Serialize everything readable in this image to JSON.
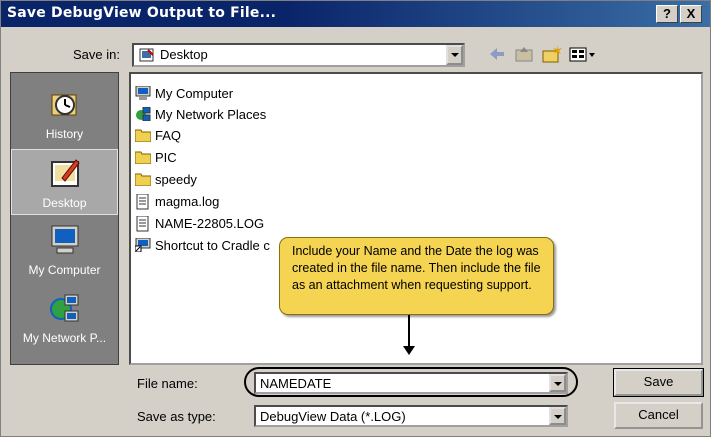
{
  "window": {
    "title": "Save DebugView Output to File...",
    "help_label": "?",
    "close_label": "X"
  },
  "save_in": {
    "label": "Save in:",
    "value": "Desktop"
  },
  "places": [
    {
      "label": "History",
      "icon": "history-icon"
    },
    {
      "label": "Desktop",
      "icon": "desktop-icon",
      "active": true
    },
    {
      "label": "My Computer",
      "icon": "my-computer-icon"
    },
    {
      "label": "My Network P...",
      "icon": "network-places-icon"
    }
  ],
  "files": [
    {
      "name": "My Computer",
      "icon": "computer-icon"
    },
    {
      "name": "My Network Places",
      "icon": "network-icon"
    },
    {
      "name": "FAQ",
      "icon": "folder-icon"
    },
    {
      "name": "PIC",
      "icon": "folder-icon"
    },
    {
      "name": "speedy",
      "icon": "folder-icon"
    },
    {
      "name": "magma.log",
      "icon": "text-file-icon"
    },
    {
      "name": "NAME-22805.LOG",
      "icon": "text-file-icon"
    },
    {
      "name": "Shortcut to Cradle c",
      "icon": "shortcut-icon"
    }
  ],
  "callout": {
    "text": "Include your Name and the Date the log was created in the file name. Then include the file as an attachment when requesting support."
  },
  "file_name": {
    "label": "File name:",
    "value": "NAMEDATE"
  },
  "save_as_type": {
    "label": "Save as type:",
    "value": "DebugView Data (*.LOG)"
  },
  "buttons": {
    "save": "Save",
    "cancel": "Cancel"
  },
  "colors": {
    "titlebar": "#0a246a",
    "callout": "#f5d452",
    "face": "#d4d0c8"
  }
}
